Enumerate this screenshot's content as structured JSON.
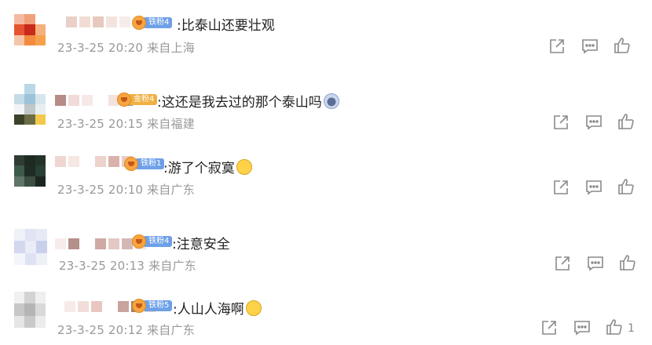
{
  "comments": [
    {
      "badge": "铁粉4",
      "text": ":比泰山还要壮观",
      "emoji": "",
      "time": "23-3-25 20:20",
      "location": "来自上海",
      "like_count": ""
    },
    {
      "badge": "金粉4",
      "text": ":这还是我去过的那个泰山吗",
      "emoji": "surprise",
      "time": "23-3-25 20:15",
      "location": "来自福建",
      "like_count": ""
    },
    {
      "badge": "铁粉1",
      "text": ":游了个寂寞",
      "emoji": "cry",
      "time": "23-3-25 20:10",
      "location": "来自广东",
      "like_count": ""
    },
    {
      "badge": "铁粉4",
      "text": ":注意安全",
      "emoji": "",
      "time": "23-3-25 20:13",
      "location": "来自广东",
      "like_count": ""
    },
    {
      "badge": "铁粉5",
      "text": ":人山人海啊",
      "emoji": "laugh",
      "time": "23-3-25 20:12",
      "location": "来自广东",
      "like_count": "1"
    }
  ],
  "icons": {
    "share": "share-icon",
    "reply": "comment-icon",
    "like": "thumbs-up-icon"
  }
}
